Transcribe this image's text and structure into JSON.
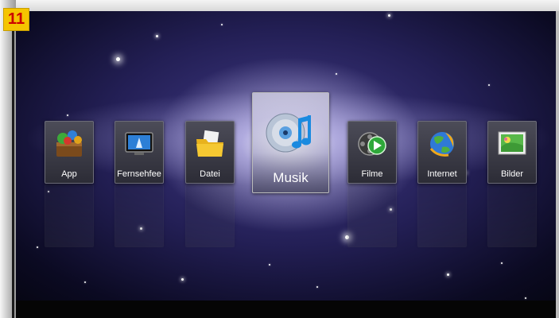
{
  "badge": "11",
  "menu": {
    "items": [
      {
        "label": "App",
        "icon": "app-store-icon"
      },
      {
        "label": "Fernsehfee",
        "icon": "tv-icon"
      },
      {
        "label": "Datei",
        "icon": "folder-icon"
      },
      {
        "label": "Musik",
        "icon": "music-disc-icon",
        "selected": true
      },
      {
        "label": "Filme",
        "icon": "film-reel-icon"
      },
      {
        "label": "Internet",
        "icon": "globe-icon"
      },
      {
        "label": "Bilder",
        "icon": "picture-icon"
      }
    ]
  }
}
